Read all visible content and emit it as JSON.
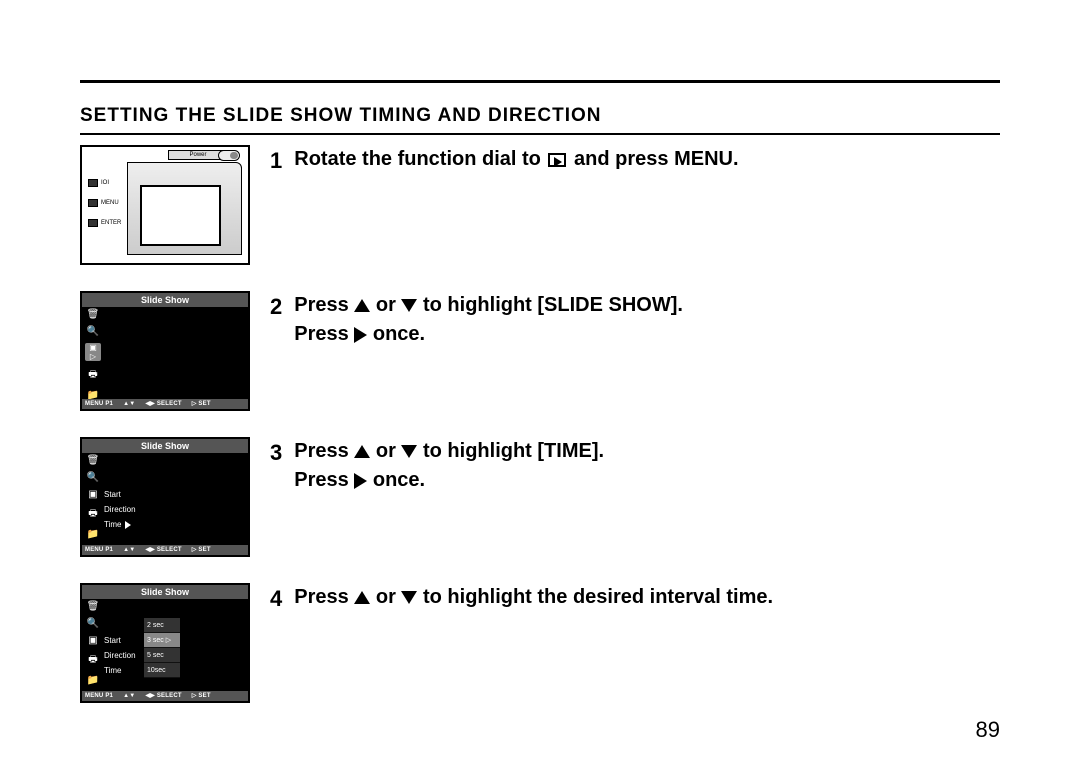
{
  "section_title": "SETTING THE SLIDE SHOW TIMING AND DIRECTION",
  "page_number": "89",
  "camera": {
    "power_label": "Power",
    "buttons": [
      "",
      "MENU",
      "ENTER"
    ],
    "ioi_label": "IOI"
  },
  "lcd_common": {
    "title": "Slide Show",
    "footer": {
      "p1": "MENU P1",
      "nav1": "▲▼",
      "nav2": "◀▶",
      "sel": "SELECT",
      "set_arrow": "▷",
      "set": "SET"
    }
  },
  "lcd2_icons": [
    "🗑",
    "🔍",
    "▣ ▷",
    "🖶",
    "📁"
  ],
  "lcd3": {
    "icons": [
      "🗑",
      "🔍",
      "▣",
      "🖶",
      "📁"
    ],
    "options": [
      "Start",
      "Direction",
      "Time"
    ],
    "time_marker": "▷"
  },
  "lcd4": {
    "icons": [
      "🗑",
      "🔍",
      "▣",
      "🖶",
      "📁"
    ],
    "options": [
      "Start",
      "Direction",
      "Time"
    ],
    "sub_options": [
      "2 sec",
      "3 sec",
      "5 sec",
      "10sec"
    ],
    "sub_selected_index": 1
  },
  "steps": [
    {
      "num": "1",
      "parts": [
        {
          "t": "text",
          "v": "Rotate the function dial to "
        },
        {
          "t": "play"
        },
        {
          "t": "text",
          "v": " and press MENU."
        }
      ]
    },
    {
      "num": "2",
      "parts": [
        {
          "t": "text",
          "v": "Press "
        },
        {
          "t": "up"
        },
        {
          "t": "text",
          "v": " or "
        },
        {
          "t": "down"
        },
        {
          "t": "text",
          "v": " to highlight [SLIDE SHOW]."
        }
      ],
      "line2": [
        {
          "t": "text",
          "v": "Press "
        },
        {
          "t": "right"
        },
        {
          "t": "text",
          "v": " once."
        }
      ]
    },
    {
      "num": "3",
      "parts": [
        {
          "t": "text",
          "v": "Press "
        },
        {
          "t": "up"
        },
        {
          "t": "text",
          "v": " or "
        },
        {
          "t": "down"
        },
        {
          "t": "text",
          "v": " to highlight [TIME]."
        }
      ],
      "line2": [
        {
          "t": "text",
          "v": "Press "
        },
        {
          "t": "right"
        },
        {
          "t": "text",
          "v": " once."
        }
      ]
    },
    {
      "num": "4",
      "parts": [
        {
          "t": "text",
          "v": "Press "
        },
        {
          "t": "up"
        },
        {
          "t": "text",
          "v": " or "
        },
        {
          "t": "down"
        },
        {
          "t": "text",
          "v": " to highlight the desired interval time."
        }
      ]
    }
  ]
}
